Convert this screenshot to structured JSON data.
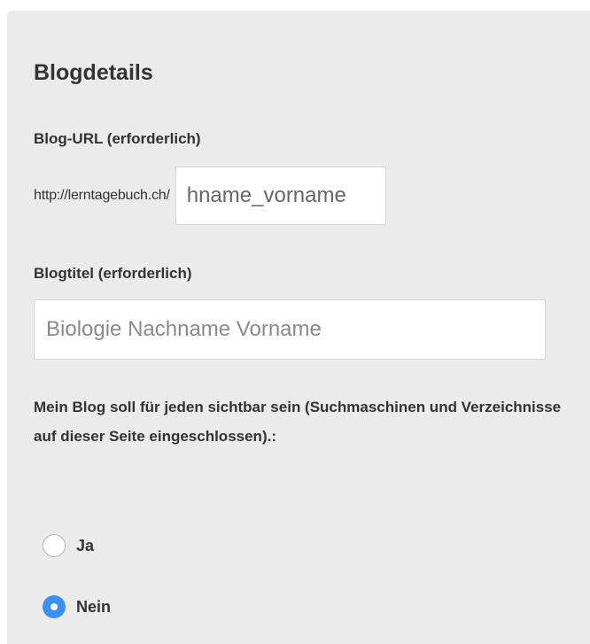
{
  "section": {
    "heading": "Blogdetails"
  },
  "blog_url": {
    "label": "Blog-URL (erforderlich)",
    "prefix": "http://lerntagebuch.ch/",
    "value": "hname_vorname"
  },
  "blog_title": {
    "label": "Blogtitel (erforderlich)",
    "placeholder": "Biologie Nachname Vorname"
  },
  "visibility": {
    "question": "Mein Blog soll für jeden sichtbar sein (Suchmaschinen und Verzeichnisse auf dieser Seite eingeschlossen).:",
    "options": [
      {
        "label": "Ja",
        "selected": false
      },
      {
        "label": "Nein",
        "selected": true
      }
    ]
  },
  "colors": {
    "panel_background": "#ebebeb",
    "radio_selected": "#3b8ff5",
    "text": "#333333"
  }
}
